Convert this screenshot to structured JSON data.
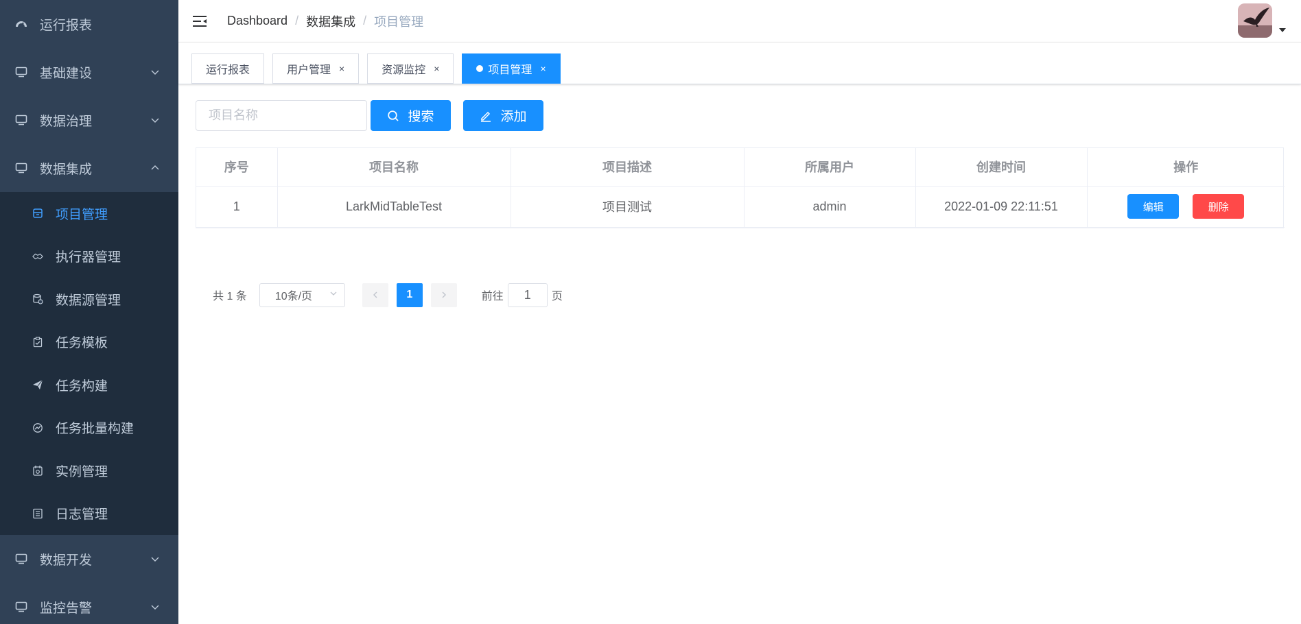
{
  "sidebar": {
    "top_items": [
      {
        "label": "运行报表",
        "icon": "dashboard-icon"
      },
      {
        "label": "基础建设",
        "icon": "monitor-icon",
        "chevron": "chevron-down-icon"
      },
      {
        "label": "数据治理",
        "icon": "monitor-icon",
        "chevron": "chevron-down-icon"
      },
      {
        "label": "数据集成",
        "icon": "monitor-icon",
        "chevron": "chevron-up-icon"
      }
    ],
    "sub_items": [
      {
        "label": "项目管理",
        "icon": "project-icon",
        "active": true
      },
      {
        "label": "执行器管理",
        "icon": "executor-icon"
      },
      {
        "label": "数据源管理",
        "icon": "datasource-icon"
      },
      {
        "label": "任务模板",
        "icon": "template-icon"
      },
      {
        "label": "任务构建",
        "icon": "send-icon"
      },
      {
        "label": "任务批量构建",
        "icon": "batch-icon"
      },
      {
        "label": "实例管理",
        "icon": "instance-icon"
      },
      {
        "label": "日志管理",
        "icon": "log-icon"
      }
    ],
    "bottom_items": [
      {
        "label": "数据开发",
        "icon": "monitor-icon",
        "chevron": "chevron-down-icon"
      },
      {
        "label": "监控告警",
        "icon": "monitor-icon",
        "chevron": "chevron-down-icon"
      }
    ],
    "bg_color": "#304156",
    "sub_bg_color": "#1f2d3d",
    "active_color": "#409eff"
  },
  "navbar": {
    "breadcrumb": [
      "Dashboard",
      "数据集成",
      "项目管理"
    ],
    "separator": "/"
  },
  "tags": [
    {
      "label": "运行报表",
      "closable": false
    },
    {
      "label": "用户管理",
      "closable": true
    },
    {
      "label": "资源监控",
      "closable": true
    },
    {
      "label": "项目管理",
      "closable": true,
      "active": true
    }
  ],
  "tag_close_glyph": "×",
  "filter": {
    "placeholder": "项目名称",
    "search_label": "搜索",
    "add_label": "添加"
  },
  "table": {
    "columns": [
      "序号",
      "项目名称",
      "项目描述",
      "所属用户",
      "创建时间",
      "操作"
    ],
    "rows": [
      {
        "index": "1",
        "name": "LarkMidTableTest",
        "description": "项目测试",
        "user": "admin",
        "created": "2022-01-09 22:11:51",
        "edit_label": "编辑",
        "delete_label": "删除"
      }
    ]
  },
  "pagination": {
    "total": "共 1 条",
    "page_size": "10条/页",
    "current_page": "1",
    "goto_label": "前往",
    "goto_value": "1",
    "page_suffix": "页"
  },
  "colors": {
    "primary": "#1890ff",
    "danger": "#ff4949"
  }
}
